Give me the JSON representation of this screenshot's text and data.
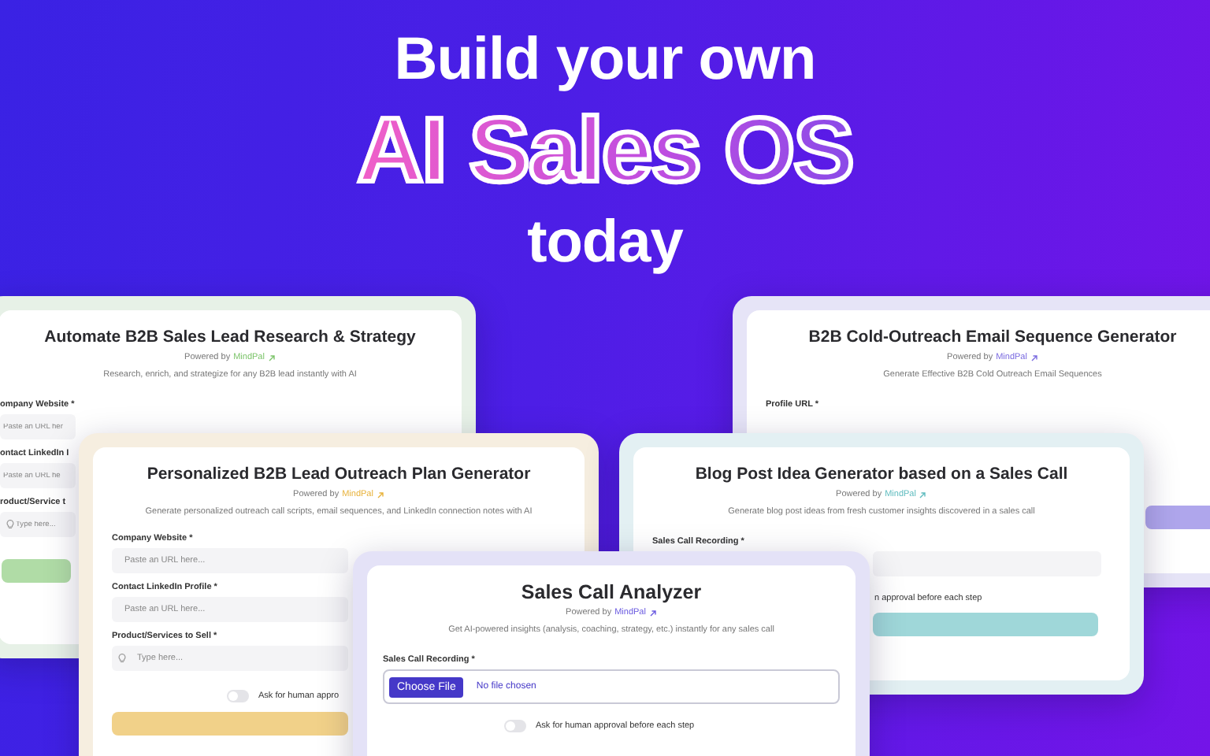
{
  "hero": {
    "line_1": "Build your own",
    "highlight": "AI Sales OS",
    "line_3": "today"
  },
  "cards": [
    {
      "title": "Automate B2B Sales Lead Research & Strategy",
      "powered_by": "Powered by",
      "brand": "MindPal",
      "color": "#7cc46a",
      "description": "Research, enrich, and strategize for any B2B lead instantly with AI",
      "fields": [
        {
          "kind": "text",
          "label": "ompany Website *",
          "placeholder": "Paste an URL her"
        },
        {
          "kind": "text",
          "label": "ontact LinkedIn I",
          "placeholder": "Paste an URL he"
        },
        {
          "kind": "prompt",
          "label": "roduct/Service t",
          "placeholder": "Type here..."
        }
      ],
      "has_button": true
    },
    {
      "title": "B2B Cold-Outreach Email Sequence Generator",
      "powered_by": "Powered by",
      "brand": "MindPal",
      "color": "#7a6ae0",
      "description": "Generate Effective B2B Cold Outreach Email Sequences",
      "fields": [
        {
          "kind": "label",
          "label": "Profile URL *"
        }
      ],
      "has_button": true
    },
    {
      "title": "Personalized B2B Lead Outreach Plan Generator",
      "powered_by": "Powered by",
      "brand": "MindPal",
      "color": "#e8b23a",
      "description": "Generate personalized outreach call scripts, email sequences, and LinkedIn connection notes with AI",
      "fields": [
        {
          "kind": "text",
          "label": "Company Website *",
          "placeholder": "Paste an URL here..."
        },
        {
          "kind": "text",
          "label": "Contact LinkedIn Profile *",
          "placeholder": "Paste an URL here..."
        },
        {
          "kind": "prompt",
          "label": "Product/Services to Sell *",
          "placeholder": "Type here..."
        }
      ],
      "toggle": {
        "label": "Ask for human appro",
        "on": false
      },
      "has_button": true
    },
    {
      "title": "Blog Post Idea Generator based on a Sales Call",
      "powered_by": "Powered by",
      "brand": "MindPal",
      "color": "#5fbcbf",
      "description": "Generate blog post ideas from fresh customer insights discovered in a sales call",
      "fields": [
        {
          "kind": "text",
          "label": "Sales Call Recording *"
        }
      ],
      "toggle": {
        "label": "n approval before each step"
      },
      "has_button": true
    },
    {
      "title": "Sales Call Analyzer",
      "powered_by": "Powered by",
      "brand": "MindPal",
      "color": "#6a5ae0",
      "description": "Get AI-powered insights (analysis, coaching, strategy, etc.) instantly for any sales call",
      "fields": [
        {
          "kind": "file",
          "label": "Sales Call Recording *",
          "button_label": "Choose File",
          "value": "No file chosen"
        }
      ],
      "toggle": {
        "label": "Ask for human approval before each step",
        "on": false
      },
      "has_button": false
    }
  ]
}
